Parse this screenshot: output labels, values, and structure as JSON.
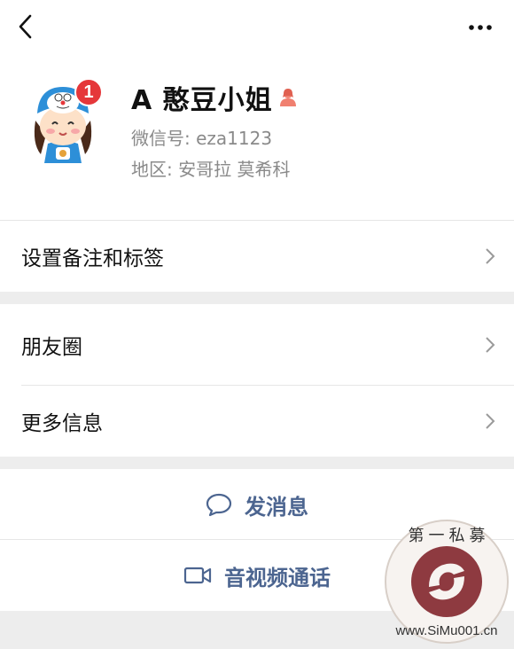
{
  "topbar": {
    "back_icon": "back-chevron-icon",
    "more_icon": "more-dots-icon"
  },
  "profile": {
    "avatar_icon": "avatar",
    "badge_count": "1",
    "name": "A 憨豆小姐",
    "gender_icon": "female-user-icon",
    "gender_color": "#f08070",
    "wechat_id": "微信号: eza1123",
    "region": "地区: 安哥拉  莫希科"
  },
  "cells": {
    "remark_label": "设置备注和标签",
    "moments_label": "朋友圈",
    "more_info_label": "更多信息"
  },
  "actions": {
    "message_label": "发消息",
    "call_label": "音视频通话",
    "accent_color": "#4c6590"
  },
  "watermark": {
    "top_text": "第 一 私 募",
    "bottom_text": "www.SiMu001.cn"
  }
}
